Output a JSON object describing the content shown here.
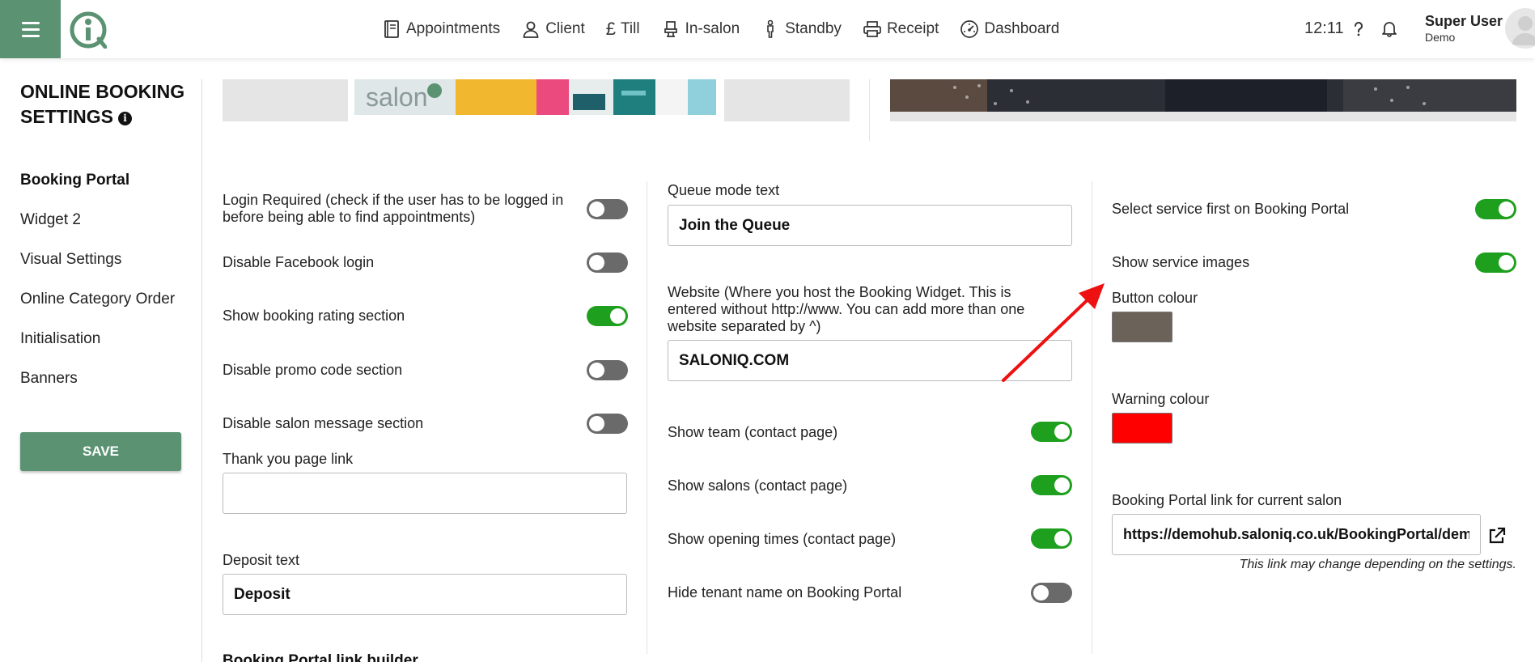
{
  "header": {
    "nav": [
      {
        "label": "Appointments",
        "icon": "book-icon"
      },
      {
        "label": "Client",
        "icon": "person-icon"
      },
      {
        "label": "Till",
        "icon": "pound-icon"
      },
      {
        "label": "In-salon",
        "icon": "chair-icon"
      },
      {
        "label": "Standby",
        "icon": "standing-person-icon"
      },
      {
        "label": "Receipt",
        "icon": "printer-icon"
      },
      {
        "label": "Dashboard",
        "icon": "gauge-icon"
      }
    ],
    "time": "12:11",
    "user_name": "Super User",
    "user_sub": "Demo",
    "pound_glyph": "£",
    "brand_color": "#5a9272"
  },
  "sidebar": {
    "title": "ONLINE BOOKING SETTINGS",
    "items": [
      {
        "label": "Booking Portal",
        "active": true
      },
      {
        "label": "Widget 2"
      },
      {
        "label": "Visual Settings"
      },
      {
        "label": "Online Category Order"
      },
      {
        "label": "Initialisation"
      },
      {
        "label": "Banners"
      }
    ],
    "save_label": "SAVE"
  },
  "banner": {
    "logo_text": "salon"
  },
  "col1": {
    "login_required": {
      "label": "Login Required (check if the user has to be logged in before being able to find appointments)",
      "on": false
    },
    "disable_facebook": {
      "label": "Disable Facebook login",
      "on": false
    },
    "show_rating": {
      "label": "Show booking rating section",
      "on": true
    },
    "disable_promo": {
      "label": "Disable promo code section",
      "on": false
    },
    "disable_salon_msg": {
      "label": "Disable salon message section",
      "on": false
    },
    "thank_you_label": "Thank you page link",
    "thank_you_value": "",
    "deposit_label": "Deposit text",
    "deposit_value": "Deposit",
    "link_builder_heading": "Booking Portal link builder"
  },
  "col2": {
    "queue_label": "Queue mode text",
    "queue_value": "Join the Queue",
    "website_label": "Website (Where you host the Booking Widget. This is entered without http://www. You can add more than one website separated by ^)",
    "website_value": "SALONIQ.COM",
    "show_team": {
      "label": "Show team (contact page)",
      "on": true
    },
    "show_salons": {
      "label": "Show salons (contact page)",
      "on": true
    },
    "show_opening": {
      "label": "Show opening times (contact page)",
      "on": true
    },
    "hide_tenant": {
      "label": "Hide tenant name on Booking Portal",
      "on": false
    }
  },
  "col3": {
    "service_first": {
      "label": "Select service first on Booking Portal",
      "on": true
    },
    "service_images": {
      "label": "Show service images",
      "on": true
    },
    "button_colour_label": "Button colour",
    "button_colour": "#6b6259",
    "warning_colour_label": "Warning colour",
    "warning_colour": "#ff0000",
    "portal_link_label": "Booking Portal link for current salon",
    "portal_link_value": "https://demohub.saloniq.co.uk/BookingPortal/demo",
    "portal_link_note": "This link may change depending on the settings."
  },
  "colors": {
    "toggle_on": "#1ea01e",
    "toggle_off": "#6a6a6a",
    "annotation_arrow": "#ee1111"
  }
}
